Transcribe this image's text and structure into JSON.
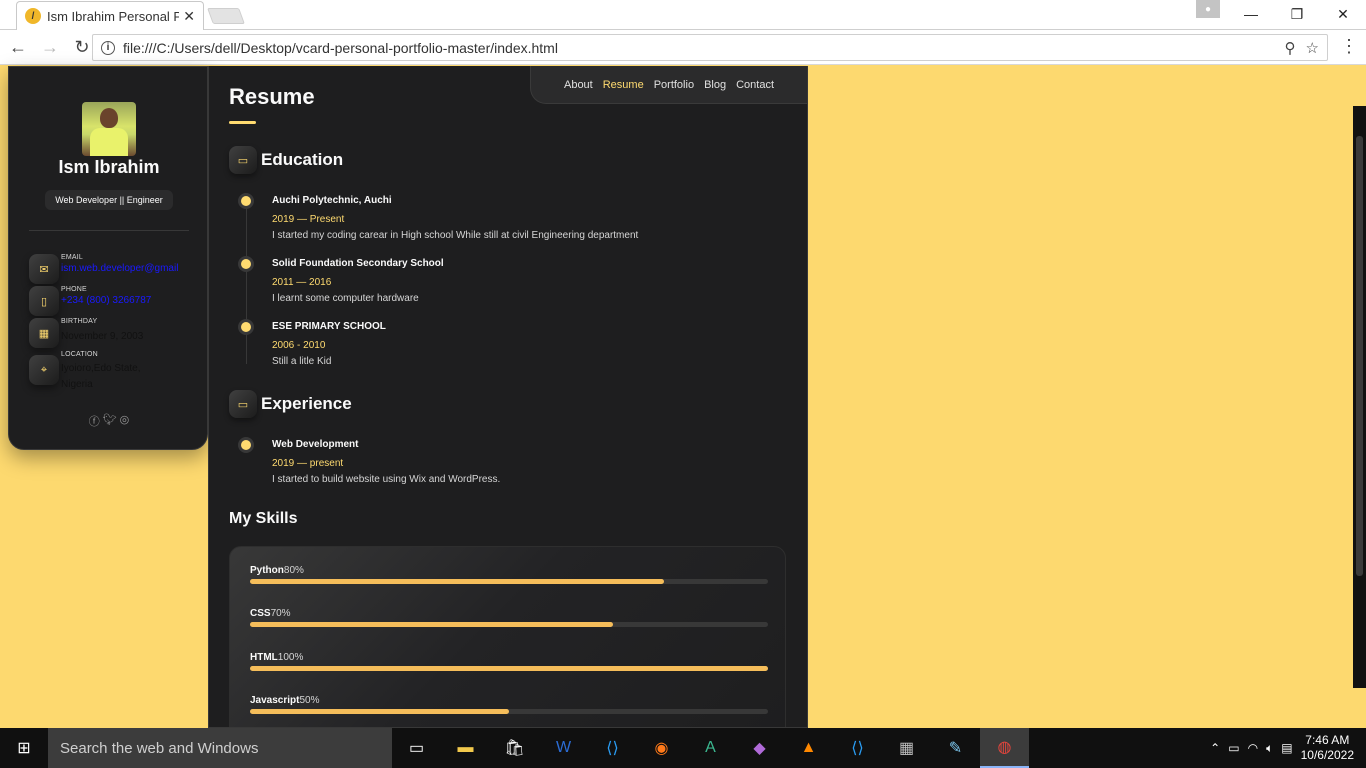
{
  "browser": {
    "tab_title": "Ism Ibrahim Personal Por",
    "url": "file:///C:/Users/dell/Desktop/vcard-personal-portfolio-master/index.html"
  },
  "sidebar": {
    "name": "Ism Ibrahim",
    "title": "Web Developer || Engineer",
    "contacts": [
      {
        "label": "EMAIL",
        "value": "ism.web.developer@gmail",
        "icon": "mail-icon"
      },
      {
        "label": "PHONE",
        "value": "+234 (800) 3266787",
        "icon": "phone-icon"
      },
      {
        "label": "BIRTHDAY",
        "value": "November 9, 2003",
        "icon": "calendar-icon"
      },
      {
        "label": "LOCATION",
        "value": "Iyoioro,Edo State, Nigeria",
        "icon": "location-icon"
      }
    ]
  },
  "nav": {
    "items": [
      "About",
      "Resume",
      "Portfolio",
      "Blog",
      "Contact"
    ],
    "active": "Resume"
  },
  "resume": {
    "heading": "Resume",
    "education_heading": "Education",
    "education": [
      {
        "title": "Auchi Polytechnic, Auchi",
        "date": "2019 — Present",
        "text": "I started my coding carear in High school While still at civil Engineering department"
      },
      {
        "title": "Solid Foundation Secondary School",
        "date": "2011 — 2016",
        "text": "I learnt some computer hardware"
      },
      {
        "title": "ESE PRIMARY SCHOOL",
        "date": "2006 - 2010",
        "text": "Still a litle Kid"
      }
    ],
    "experience_heading": "Experience",
    "experience": [
      {
        "title": "Web Development",
        "date": "2019 — present",
        "text": "I started to build website using Wix and WordPress."
      }
    ],
    "skills_heading": "My Skills",
    "skills": [
      {
        "name": "Python",
        "pct": "80%",
        "value": 80
      },
      {
        "name": "CSS",
        "pct": "70%",
        "value": 70
      },
      {
        "name": "HTML",
        "pct": "100%",
        "value": 100
      },
      {
        "name": "Javascript",
        "pct": "50%",
        "value": 50
      }
    ]
  },
  "taskbar": {
    "search_placeholder": "Search the web and Windows",
    "time": "7:46 AM",
    "date": "10/6/2022"
  },
  "colors": {
    "accent": "#ffdb70",
    "page_bg": "#fdd96f",
    "card_bg": "#1e1e1f"
  }
}
